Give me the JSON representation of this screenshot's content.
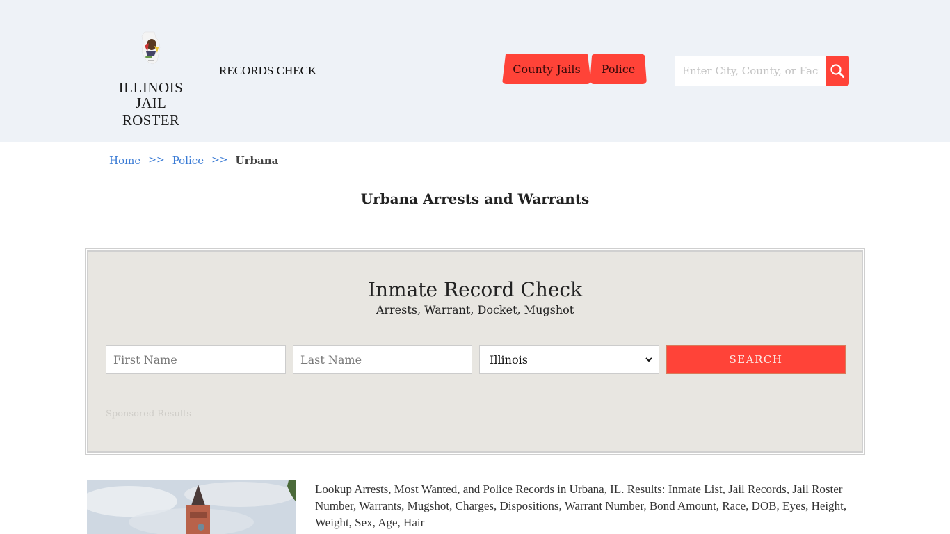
{
  "header": {
    "logo": {
      "line1": "ILLINOIS",
      "line2": "JAIL ROSTER",
      "seal_icon": "illinois-state-seal-icon"
    },
    "records_check": "RECORDS CHECK",
    "nav": [
      {
        "label": "County Jails"
      },
      {
        "label": "Police"
      }
    ],
    "search": {
      "placeholder": "Enter City, County, or Facility",
      "icon": "search-icon"
    }
  },
  "colors": {
    "accent": "#ff4338",
    "header_bg": "#eef2f7",
    "panel_bg": "#e8e6e1",
    "link": "#3a7bd5"
  },
  "breadcrumb": {
    "items": [
      {
        "label": "Home"
      },
      {
        "label": "Police"
      }
    ],
    "separator": ">>",
    "current": "Urbana"
  },
  "page_title": "Urbana Arrests and Warrants",
  "record_check": {
    "title": "Inmate Record Check",
    "subtitle": "Arrests, Warrant, Docket, Mugshot",
    "first_name_placeholder": "First Name",
    "last_name_placeholder": "Last Name",
    "state_selected": "Illinois",
    "search_label": "SEARCH",
    "sponsored": "Sponsored Results"
  },
  "content": {
    "image_alt": "Urbana clock tower",
    "description": "Lookup Arrests, Most Wanted, and Police Records in Urbana, IL. Results: Inmate List, Jail Records, Jail Roster Number, Warrants, Mugshot, Charges, Dispositions, Warrant Number, Bond Amount, Race, DOB, Eyes, Height, Weight, Sex, Age, Hair"
  }
}
